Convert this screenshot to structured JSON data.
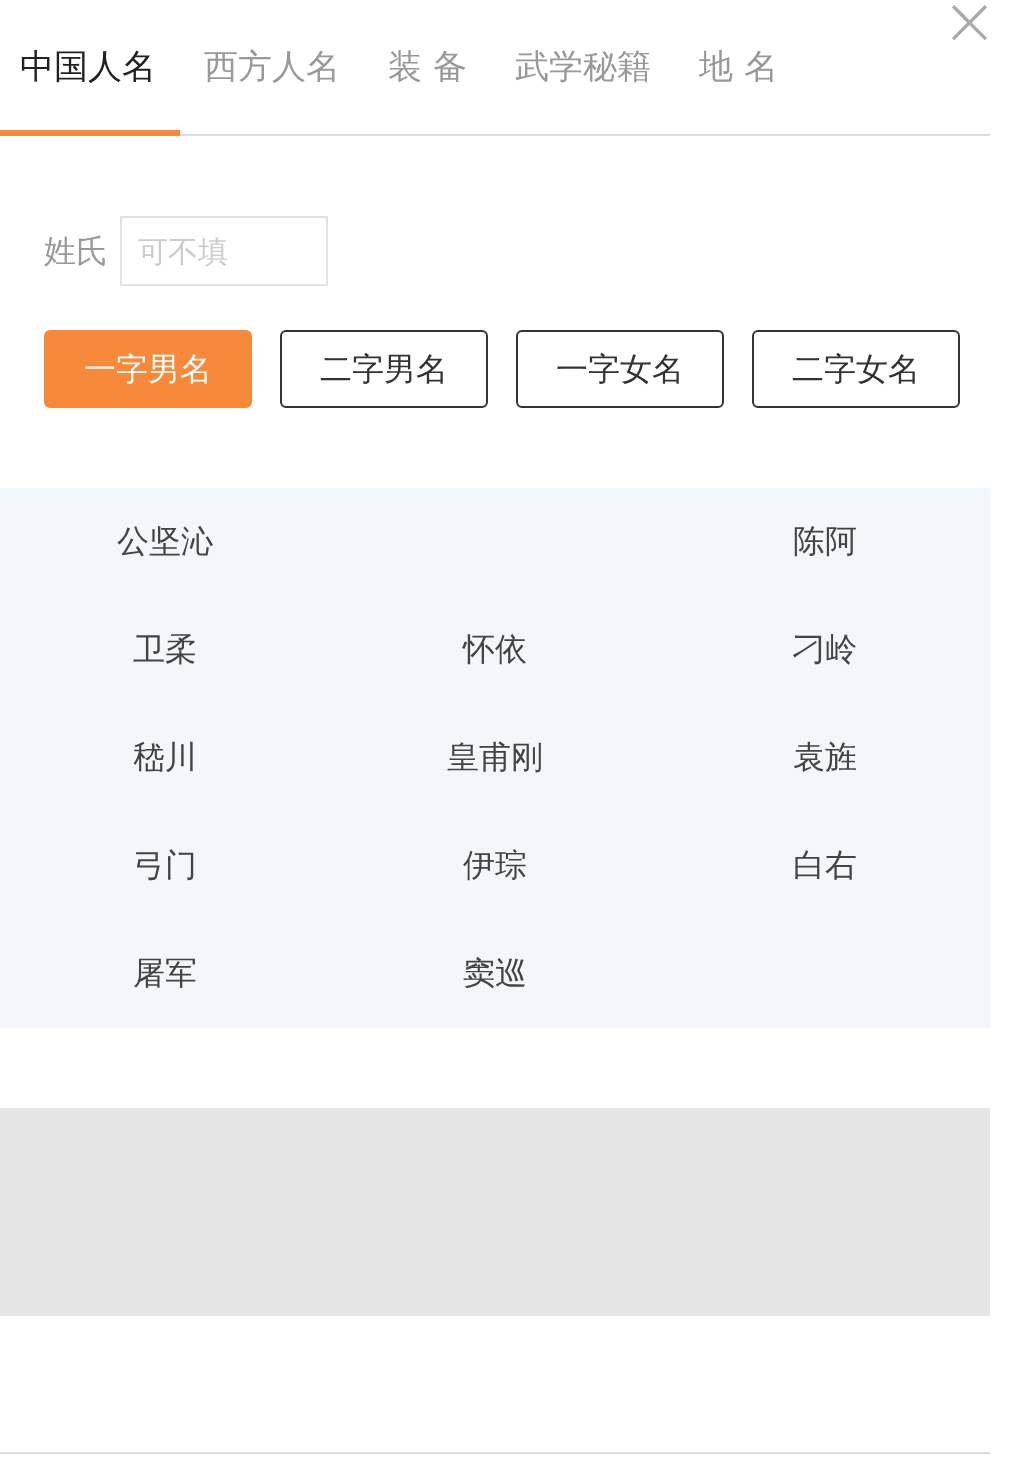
{
  "close_button": {
    "label": "×"
  },
  "tabs": [
    {
      "label": "中国人名",
      "selected": true
    },
    {
      "label": "西方人名",
      "selected": false
    },
    {
      "label": "装 备",
      "selected": false
    },
    {
      "label": "武学秘籍",
      "selected": false
    },
    {
      "label": "地 名",
      "selected": false
    }
  ],
  "surname": {
    "label": "姓氏",
    "placeholder": "可不填"
  },
  "name_types": [
    {
      "label": "一字男名",
      "selected": true
    },
    {
      "label": "二字男名",
      "selected": false
    },
    {
      "label": "一字女名",
      "selected": false
    },
    {
      "label": "二字女名",
      "selected": false
    }
  ],
  "names": [
    {
      "column_1": "公坚沁",
      "column_3": "陈阿"
    },
    {
      "column_1": "卫柔",
      "column_2": "怀依",
      "column_3": "刁岭"
    },
    {
      "column_1": "嵇川",
      "column_2": "皇甫刚",
      "column_3": "袁旌"
    },
    {
      "column_1": "弓门",
      "column_2": "伊琮",
      "column_3": "白右"
    },
    {
      "column_1": "屠军",
      "column_2": "窦巡"
    }
  ]
}
